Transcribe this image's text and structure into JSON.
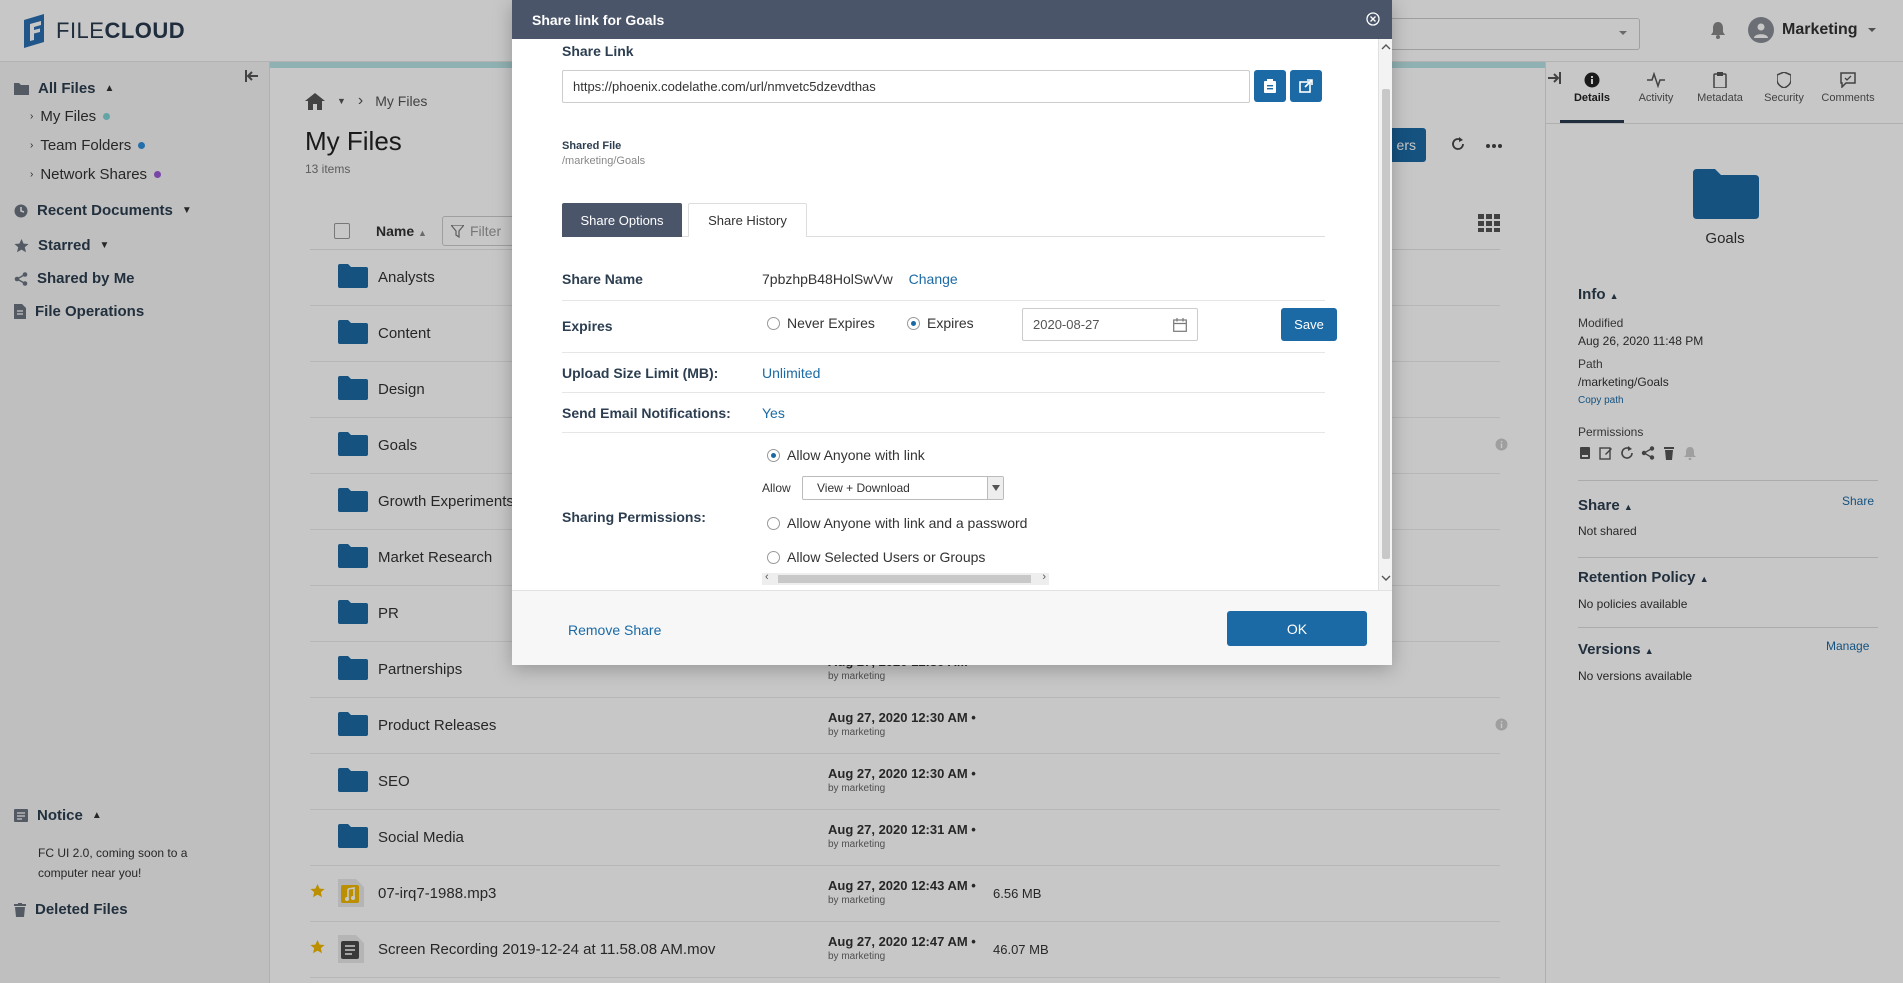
{
  "header": {
    "logo_light": "FILE",
    "logo_bold": "CLOUD",
    "user_name": "Marketing"
  },
  "sidebar": {
    "all_files": "All Files",
    "children": [
      {
        "label": "My Files",
        "dot_color": "#7fd3d6"
      },
      {
        "label": "Team Folders",
        "dot_color": "#2f8fdc"
      },
      {
        "label": "Network Shares",
        "dot_color": "#9b59d6"
      }
    ],
    "recent_documents": "Recent Documents",
    "starred": "Starred",
    "shared_by_me": "Shared by Me",
    "file_operations": "File Operations",
    "notice": "Notice",
    "notice_text": "FC UI 2.0, coming soon to a computer near you!",
    "deleted_files": "Deleted Files"
  },
  "main": {
    "breadcrumb": "My Files",
    "title": "My Files",
    "item_count": "13 items",
    "add_button_label": "ers",
    "column_name": "Name",
    "filter_placeholder": "Filter",
    "rows": [
      {
        "name": "Analysts",
        "type": "folder",
        "date": "",
        "by": "",
        "size": "",
        "info": false,
        "starred": false
      },
      {
        "name": "Content",
        "type": "folder",
        "date": "",
        "by": "",
        "size": "",
        "info": false,
        "starred": false
      },
      {
        "name": "Design",
        "type": "folder",
        "date": "",
        "by": "",
        "size": "",
        "info": false,
        "starred": false
      },
      {
        "name": "Goals",
        "type": "folder",
        "date": "",
        "by": "",
        "size": "",
        "info": true,
        "starred": false
      },
      {
        "name": "Growth Experiments",
        "type": "folder",
        "date": "",
        "by": "",
        "size": "",
        "info": false,
        "starred": false
      },
      {
        "name": "Market Research",
        "type": "folder",
        "date": "",
        "by": "",
        "size": "",
        "info": false,
        "starred": false
      },
      {
        "name": "PR",
        "type": "folder",
        "date": "",
        "by": "",
        "size": "",
        "info": false,
        "starred": false
      },
      {
        "name": "Partnerships",
        "type": "folder",
        "date": "Aug 27, 2020 12:30 AM •",
        "by": "by marketing",
        "size": "",
        "info": false,
        "starred": false
      },
      {
        "name": "Product Releases",
        "type": "folder",
        "date": "Aug 27, 2020 12:30 AM •",
        "by": "by marketing",
        "size": "",
        "info": true,
        "starred": false
      },
      {
        "name": "SEO",
        "type": "folder",
        "date": "Aug 27, 2020 12:30 AM •",
        "by": "by marketing",
        "size": "",
        "info": false,
        "starred": false
      },
      {
        "name": "Social Media",
        "type": "folder",
        "date": "Aug 27, 2020 12:31 AM •",
        "by": "by marketing",
        "size": "",
        "info": false,
        "starred": false
      },
      {
        "name": "07-irq7-1988.mp3",
        "type": "audio",
        "date": "Aug 27, 2020 12:43 AM •",
        "by": "by marketing",
        "size": "6.56 MB",
        "info": false,
        "starred": true
      },
      {
        "name": "Screen Recording 2019-12-24 at 11.58.08 AM.mov",
        "type": "video",
        "date": "Aug 27, 2020 12:47 AM •",
        "by": "by marketing",
        "size": "46.07 MB",
        "info": false,
        "starred": true
      }
    ]
  },
  "right_panel": {
    "tabs": [
      {
        "label": "Details",
        "icon": "info-icon",
        "active": true
      },
      {
        "label": "Activity",
        "icon": "activity-icon",
        "active": false
      },
      {
        "label": "Metadata",
        "icon": "clipboard-icon",
        "active": false
      },
      {
        "label": "Security",
        "icon": "shield-icon",
        "active": false
      },
      {
        "label": "Comments",
        "icon": "comment-icon",
        "active": false
      }
    ],
    "folder_name": "Goals",
    "info_title": "Info",
    "modified_label": "Modified",
    "modified_value": "Aug 26, 2020 11:48 PM",
    "path_label": "Path",
    "path_value": "/marketing/Goals",
    "copy_path": "Copy path",
    "permissions_label": "Permissions",
    "share_title": "Share",
    "share_link": "Share",
    "share_value": "Not shared",
    "retention_title": "Retention Policy",
    "retention_value": "No policies available",
    "versions_title": "Versions",
    "versions_link": "Manage",
    "versions_value": "No versions available"
  },
  "modal": {
    "title": "Share link for Goals",
    "share_link_label": "Share Link",
    "share_url": "https://phoenix.codelathe.com/url/nmvetc5dzevdthas",
    "shared_file_label": "Shared File",
    "shared_file_path": "/marketing/Goals",
    "tab_options": "Share Options",
    "tab_history": "Share History",
    "share_name_label": "Share Name",
    "share_name_value": "7pbzhpB48HolSwVw",
    "change_link": "Change",
    "expires_label": "Expires",
    "never_expires": "Never Expires",
    "expires_option": "Expires",
    "expires_date": "2020-08-27",
    "save_button": "Save",
    "upload_limit_label": "Upload Size Limit (MB):",
    "upload_limit_value": "Unlimited",
    "email_notif_label": "Send Email Notifications:",
    "email_notif_value": "Yes",
    "sharing_perm_label": "Sharing Permissions:",
    "perm_anyone": "Allow Anyone with link",
    "allow_label": "Allow",
    "allow_value": "View + Download",
    "perm_password": "Allow Anyone with link and a password",
    "perm_selected": "Allow Selected Users or Groups",
    "remove_share": "Remove Share",
    "ok_button": "OK"
  },
  "colors": {
    "accent": "#1b6aa5",
    "header_dark": "#4a5569",
    "folder": "#1b6aa5"
  }
}
